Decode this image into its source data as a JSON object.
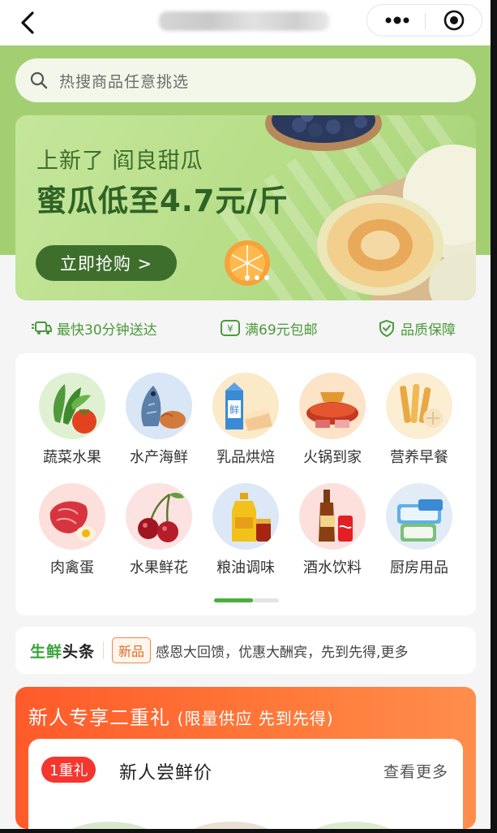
{
  "topbar": {
    "back_icon": "chevron-left-icon",
    "more_icon": "more-dots-icon",
    "close_icon": "target-close-icon"
  },
  "search": {
    "placeholder": "热搜商品任意挑选",
    "icon": "search-icon"
  },
  "banner": {
    "subtitle": "上新了 阎良甜瓜",
    "headline": "蜜瓜低至4.7元/斤",
    "cta": "立即抢购 >"
  },
  "services": [
    {
      "icon": "delivery-truck-icon",
      "label": "最快30分钟送达"
    },
    {
      "icon": "yen-coupon-icon",
      "label": "满69元包邮"
    },
    {
      "icon": "shield-check-icon",
      "label": "品质保障"
    }
  ],
  "categories": [
    {
      "label": "蔬菜水果",
      "icon": "vegetables-fruit-icon"
    },
    {
      "label": "水产海鲜",
      "icon": "seafood-icon"
    },
    {
      "label": "乳品烘焙",
      "icon": "dairy-bakery-icon"
    },
    {
      "label": "火锅到家",
      "icon": "hotpot-icon"
    },
    {
      "label": "营养早餐",
      "icon": "breakfast-icon"
    },
    {
      "label": "肉禽蛋",
      "icon": "meat-egg-icon"
    },
    {
      "label": "水果鲜花",
      "icon": "cherry-flower-icon"
    },
    {
      "label": "粮油调味",
      "icon": "oil-seasoning-icon"
    },
    {
      "label": "酒水饮料",
      "icon": "drinks-icon"
    },
    {
      "label": "厨房用品",
      "icon": "kitchen-paper-icon"
    }
  ],
  "pager": {
    "current": 1,
    "total": 2
  },
  "headlines": {
    "title_green": "生鲜",
    "title_black": "头条",
    "tag": "新品",
    "text": "感恩大回馈，优惠大酬宾，先到先得,更多"
  },
  "promo": {
    "title": "新人专享二重礼",
    "title_note": "(限量供应 先到先得)",
    "gift_badge": "1重礼",
    "gift_title": "新人尝鲜价",
    "see_more": "查看更多"
  },
  "colors": {
    "brand_green": "#a3cf72",
    "dark_green": "#3e6e2c",
    "service_green": "#4a9a3a",
    "promo_orange": "#ff5a2a",
    "badge_red": "#f5362f"
  }
}
